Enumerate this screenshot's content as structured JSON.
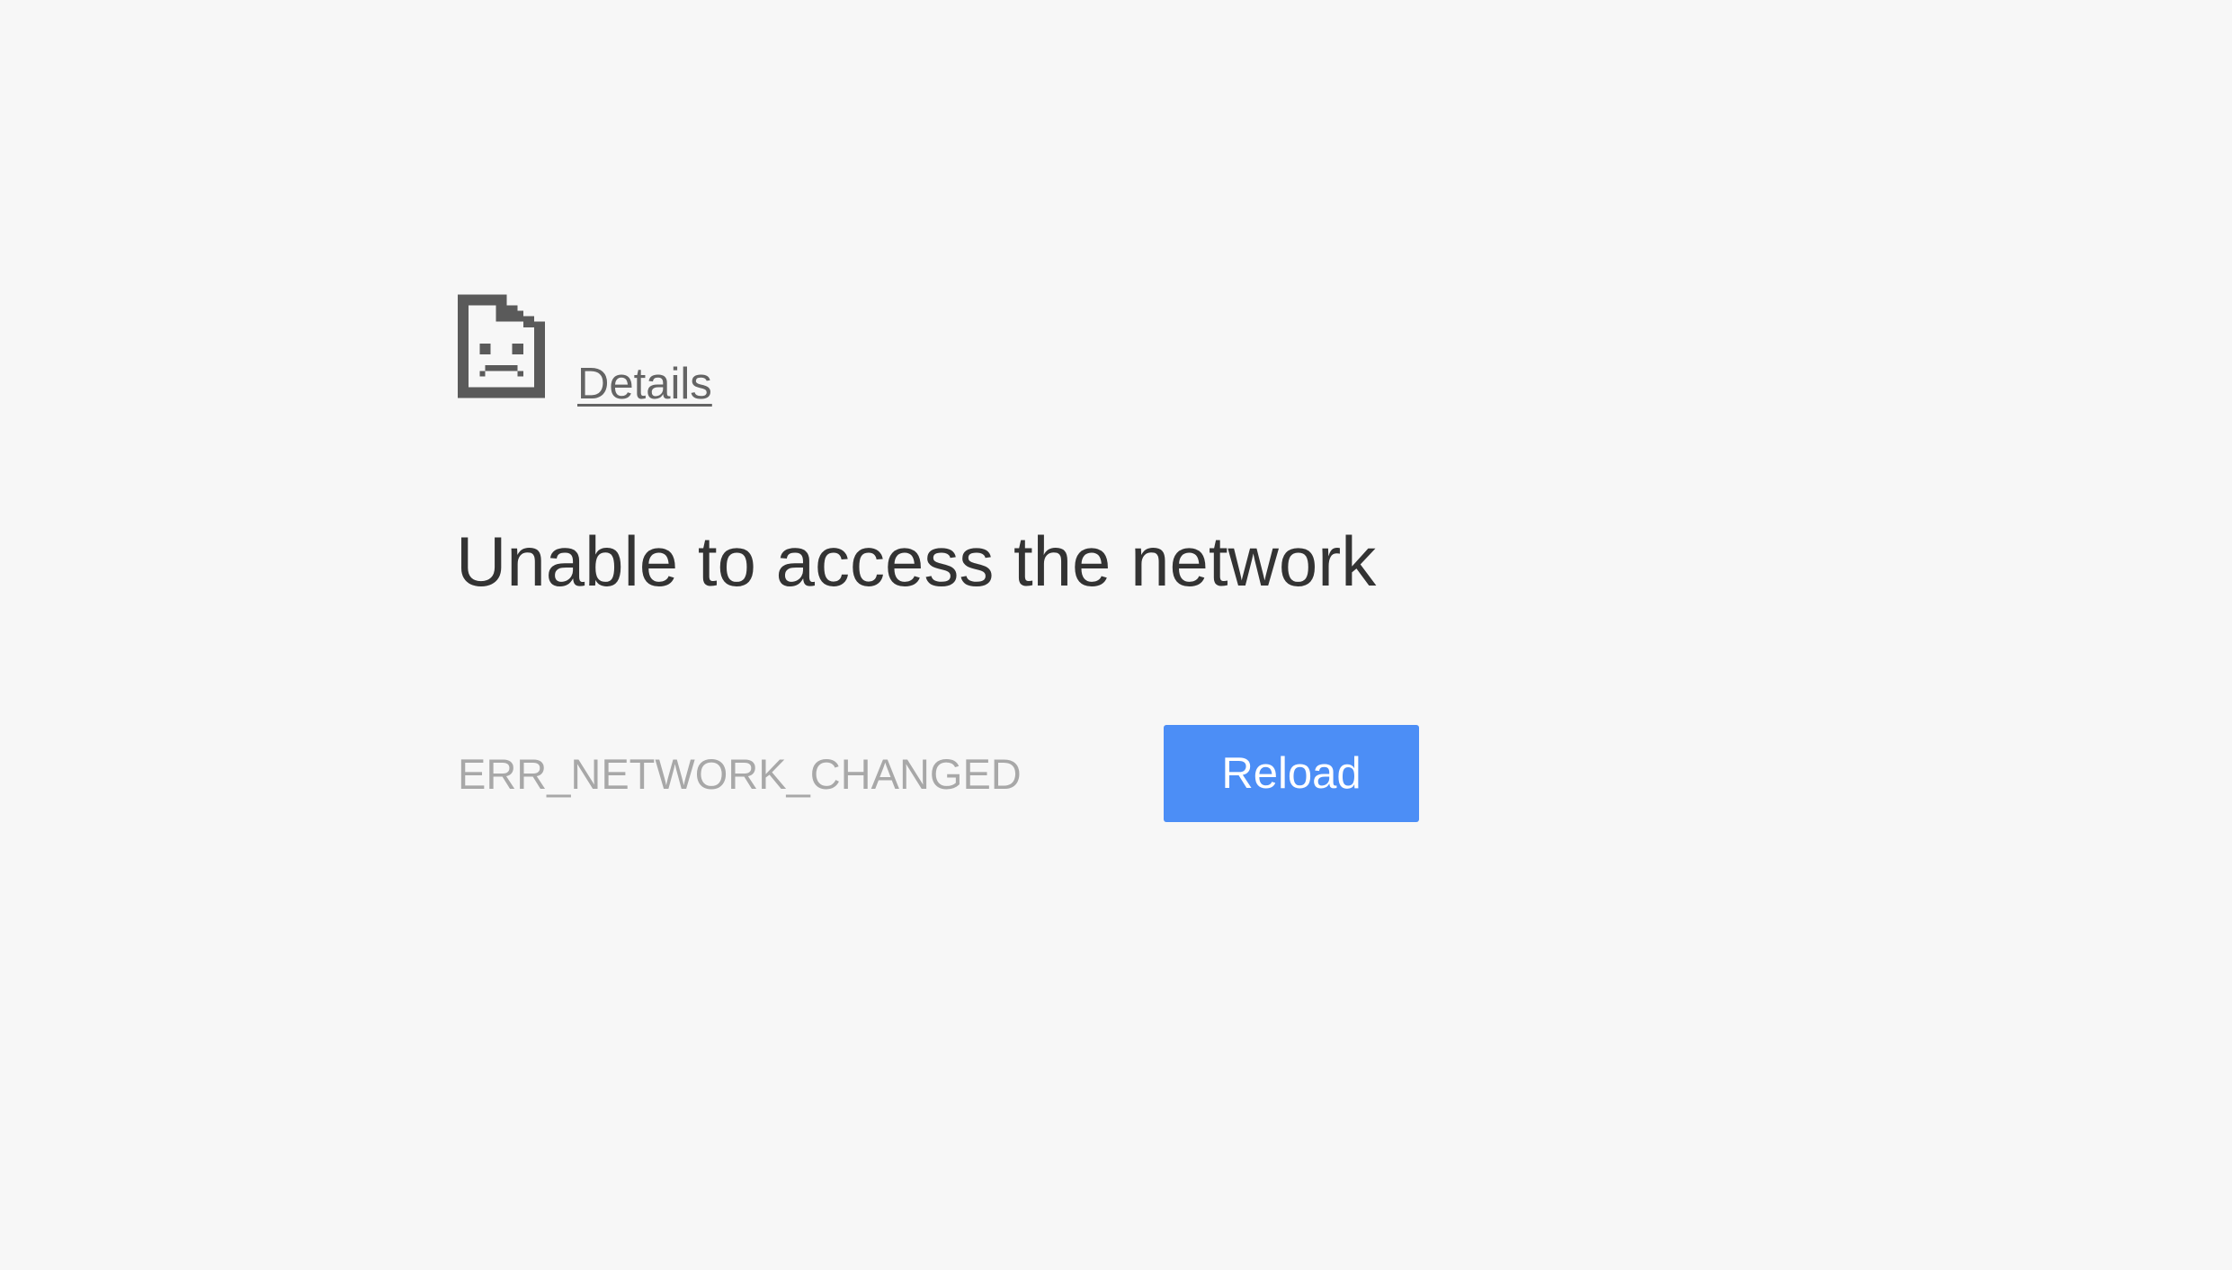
{
  "error_page": {
    "icon": "sad-document-icon",
    "details_label": "Details",
    "title": "Unable to access the network",
    "error_code": "ERR_NETWORK_CHANGED",
    "reload_label": "Reload"
  },
  "colors": {
    "background": "#f7f7f7",
    "icon": "#5a5a5a",
    "title": "#333333",
    "details_link": "#646464",
    "error_code": "#a8a8a8",
    "reload_button": "#4c8ef6",
    "reload_text": "#ffffff"
  }
}
